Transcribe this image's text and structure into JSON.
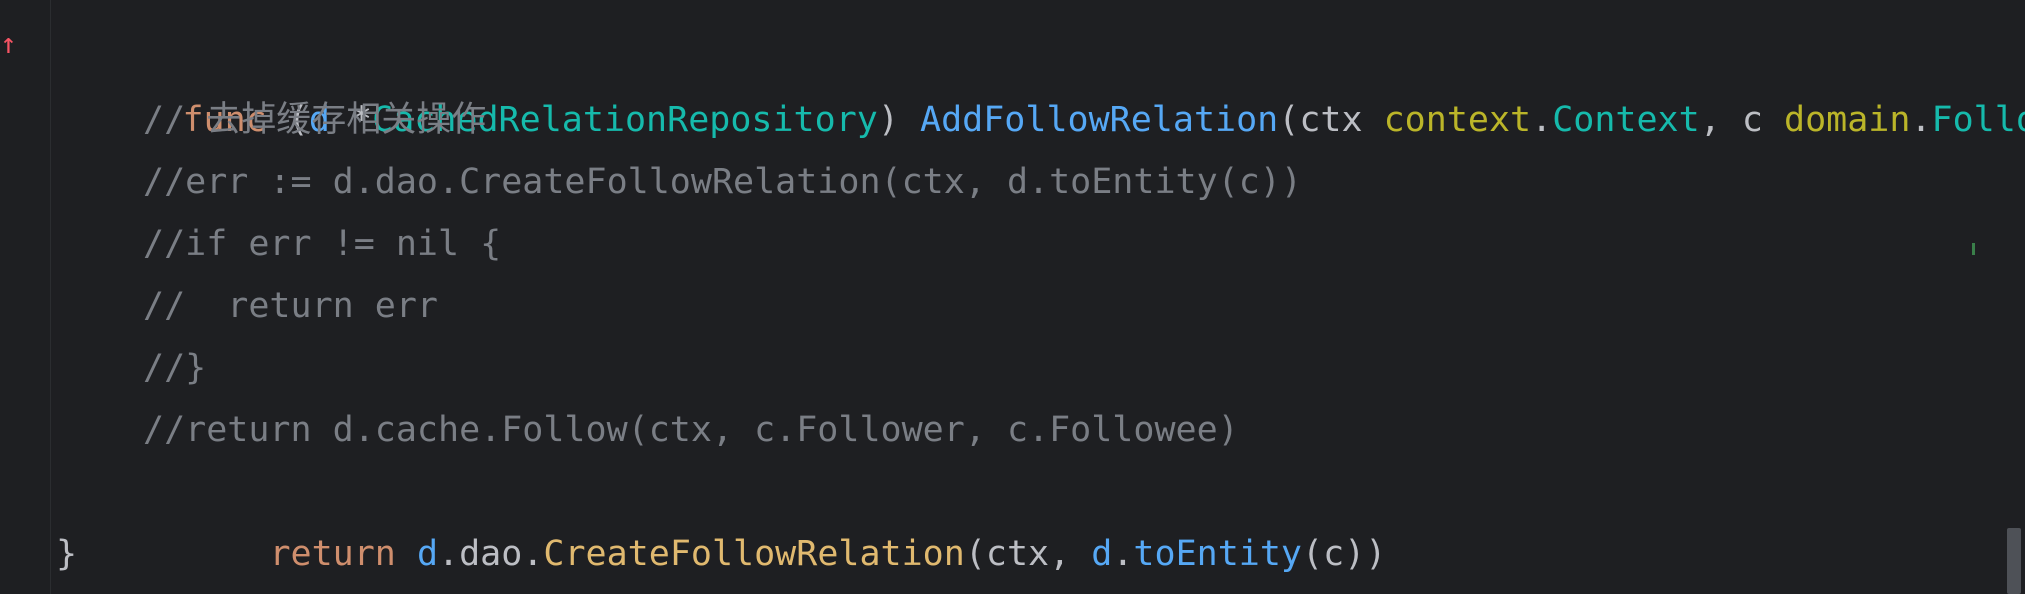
{
  "gutter": {
    "marker": "↑"
  },
  "code": {
    "line1": {
      "func": "func",
      "open": " (",
      "recv": "d",
      "star": " *",
      "type": "CachedRelationRepository",
      "close": ") ",
      "name": "AddFollowRelation",
      "paren": "(ctx ",
      "pkg1": "context",
      "dot1": ".",
      "type1": "Context",
      "comma": ", c ",
      "pkg2": "domain",
      "dot2": ".",
      "type2": "Follow"
    },
    "line2": "// 去掉缓存相关操作",
    "line3": "//err := d.dao.CreateFollowRelation(ctx, d.toEntity(c))",
    "line4": "//if err != nil {",
    "line5": "//  return err",
    "line6": "//}",
    "line7": "//return d.cache.Follow(ctx, c.Follower, c.Followee)",
    "line8": {
      "ret": "return",
      "sp": " ",
      "d1": "d",
      "dao": ".dao.",
      "create": "CreateFollowRelation",
      "args1": "(ctx, ",
      "d2": "d",
      "dot": ".",
      "toEntity": "toEntity",
      "args2": "(c))"
    },
    "line9": "}"
  }
}
